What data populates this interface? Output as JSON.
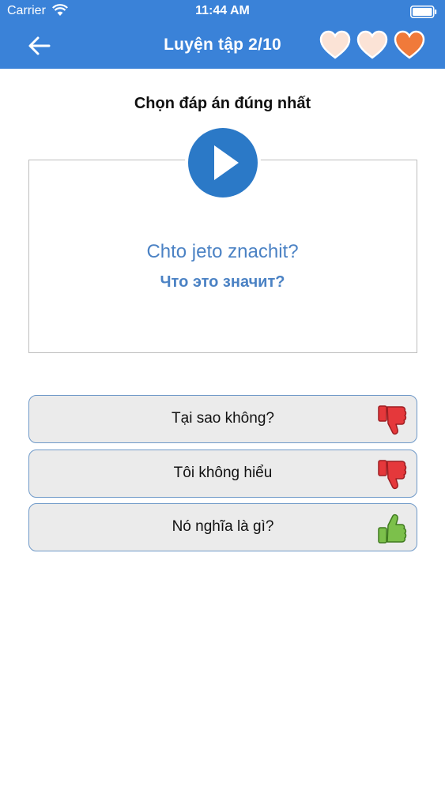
{
  "status_bar": {
    "carrier": "Carrier",
    "time": "11:44 AM"
  },
  "nav": {
    "title": "Luyện tập 2/10",
    "hearts": [
      {
        "icon": "heart-empty-icon",
        "state": "lost"
      },
      {
        "icon": "heart-empty-icon",
        "state": "lost"
      },
      {
        "icon": "heart-full-icon",
        "state": "remaining"
      }
    ]
  },
  "instruction": "Chọn đáp án đúng nhất",
  "question": {
    "transliteration": "Chto jeto znachit?",
    "cyrillic": "Что это значит?"
  },
  "answers": [
    {
      "label": "Tại sao không?",
      "feedback": "thumbs-down-icon",
      "correct": false
    },
    {
      "label": "Tôi không hiểu",
      "feedback": "thumbs-down-icon",
      "correct": false
    },
    {
      "label": "Nó nghĩa là gì?",
      "feedback": "thumbs-up-icon",
      "correct": true
    }
  ],
  "colors": {
    "primary": "#3a82d8",
    "question_text": "#4b82c4",
    "wrong": "#e5383b",
    "right": "#7cc04b"
  }
}
